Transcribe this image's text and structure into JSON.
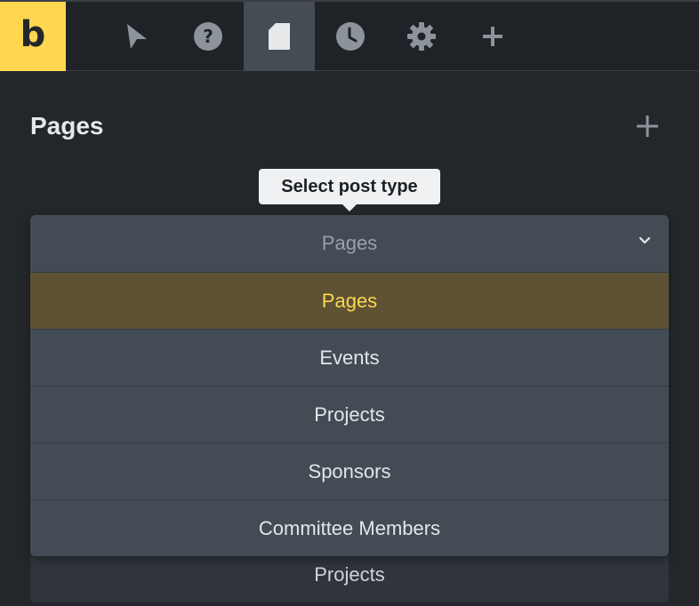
{
  "toolbar": {
    "logo_letter": "b",
    "items": [
      {
        "icon": "cursor-icon"
      },
      {
        "icon": "help-icon"
      },
      {
        "icon": "page-icon",
        "active": true
      },
      {
        "icon": "history-icon"
      },
      {
        "icon": "settings-icon"
      },
      {
        "icon": "add-icon"
      }
    ]
  },
  "panel": {
    "title": "Pages"
  },
  "tooltip": {
    "text": "Select post type"
  },
  "post_type_select": {
    "selected_value": "Pages",
    "options": [
      "Pages",
      "Events",
      "Projects",
      "Sponsors",
      "Committee Members"
    ]
  },
  "behind_list": {
    "visible_item": "Projects"
  },
  "colors": {
    "accent": "#ffd64f",
    "background": "#23272b",
    "dropdown": "#434c55",
    "selected_option": "#5d5234"
  }
}
